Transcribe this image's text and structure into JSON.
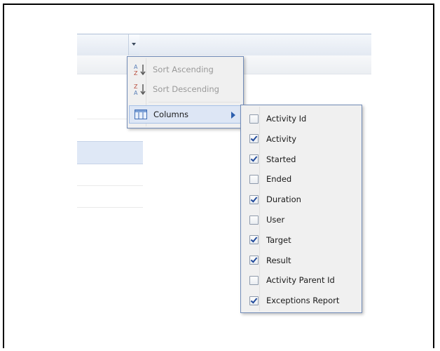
{
  "sort_menu": {
    "items": [
      {
        "label": "Sort Ascending",
        "icon": "sort-ascending-icon",
        "enabled": false
      },
      {
        "label": "Sort Descending",
        "icon": "sort-descending-icon",
        "enabled": false
      }
    ],
    "columns_item": {
      "label": "Columns",
      "icon": "columns-icon"
    }
  },
  "columns_menu": {
    "items": [
      {
        "label": "Activity Id",
        "checked": false
      },
      {
        "label": "Activity",
        "checked": true
      },
      {
        "label": "Started",
        "checked": true
      },
      {
        "label": "Ended",
        "checked": false
      },
      {
        "label": "Duration",
        "checked": true
      },
      {
        "label": "User",
        "checked": false
      },
      {
        "label": "Target",
        "checked": true
      },
      {
        "label": "Result",
        "checked": true
      },
      {
        "label": "Activity Parent Id",
        "checked": false
      },
      {
        "label": "Exceptions Report",
        "checked": true
      }
    ]
  },
  "colors": {
    "menu_border": "#718bb7",
    "check": "#214a9b",
    "selected_row": "#dfe8f6"
  }
}
